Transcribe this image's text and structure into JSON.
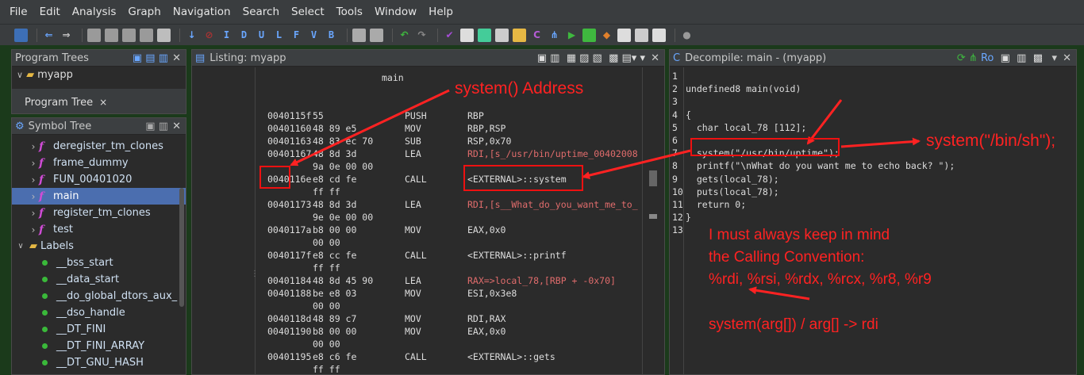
{
  "menu": [
    "File",
    "Edit",
    "Analysis",
    "Graph",
    "Navigation",
    "Search",
    "Select",
    "Tools",
    "Window",
    "Help"
  ],
  "toolbar_letters": [
    "I",
    "D",
    "U",
    "L",
    "F",
    "V",
    "B"
  ],
  "program_trees": {
    "title": "Program Trees",
    "root": "myapp",
    "tab": "Program Tree",
    "tab_close": "×"
  },
  "symbol_tree": {
    "title": "Symbol Tree",
    "functions": [
      "deregister_tm_clones",
      "frame_dummy",
      "FUN_00401020",
      "main",
      "register_tm_clones",
      "test"
    ],
    "selected": "main",
    "labels_folder": "Labels",
    "labels": [
      "__bss_start",
      "__data_start",
      "__do_global_dtors_aux_",
      "__dso_handle",
      "__DT_FINI",
      "__DT_FINI_ARRAY",
      "__DT_GNU_HASH"
    ]
  },
  "listing": {
    "title": "Listing:  myapp",
    "function_label": "main",
    "rows": [
      {
        "addr": "0040115f",
        "bytes": "55",
        "mn": "PUSH",
        "op": "RBP"
      },
      {
        "addr": "00401160",
        "bytes": "48 89 e5",
        "mn": "MOV",
        "op": "RBP,RSP"
      },
      {
        "addr": "00401163",
        "bytes": "48 83 ec 70",
        "mn": "SUB",
        "op": "RSP,0x70"
      },
      {
        "addr": "00401167",
        "bytes": "48 8d 3d",
        "mn": "LEA",
        "op": "RDI,[s_/usr/bin/uptime_00402008"
      },
      {
        "addr": "",
        "bytes": "9a 0e 00 00",
        "mn": "",
        "op": ""
      },
      {
        "addr": "0040116e",
        "bytes": "e8 cd fe",
        "mn": "CALL",
        "op": "<EXTERNAL>::system"
      },
      {
        "addr": "",
        "bytes": "ff ff",
        "mn": "",
        "op": ""
      },
      {
        "addr": "00401173",
        "bytes": "48 8d 3d",
        "mn": "LEA",
        "op": "RDI,[s__What_do_you_want_me_to_"
      },
      {
        "addr": "",
        "bytes": "9e 0e 00 00",
        "mn": "",
        "op": ""
      },
      {
        "addr": "0040117a",
        "bytes": "b8 00 00",
        "mn": "MOV",
        "op": "EAX,0x0"
      },
      {
        "addr": "",
        "bytes": "00 00",
        "mn": "",
        "op": ""
      },
      {
        "addr": "0040117f",
        "bytes": "e8 cc fe",
        "mn": "CALL",
        "op": "<EXTERNAL>::printf"
      },
      {
        "addr": "",
        "bytes": "ff ff",
        "mn": "",
        "op": ""
      },
      {
        "addr": "00401184",
        "bytes": "48 8d 45 90",
        "mn": "LEA",
        "op": "RAX=>local_78,[RBP + -0x70]"
      },
      {
        "addr": "00401188",
        "bytes": "be e8 03",
        "mn": "MOV",
        "op": "ESI,0x3e8"
      },
      {
        "addr": "",
        "bytes": "00 00",
        "mn": "",
        "op": ""
      },
      {
        "addr": "0040118d",
        "bytes": "48 89 c7",
        "mn": "MOV",
        "op": "RDI,RAX"
      },
      {
        "addr": "00401190",
        "bytes": "b8 00 00",
        "mn": "MOV",
        "op": "EAX,0x0"
      },
      {
        "addr": "",
        "bytes": "00 00",
        "mn": "",
        "op": ""
      },
      {
        "addr": "00401195",
        "bytes": "e8 c6 fe",
        "mn": "CALL",
        "op": "<EXTERNAL>::gets"
      },
      {
        "addr": "",
        "bytes": "ff ff",
        "mn": "",
        "op": ""
      }
    ]
  },
  "decompile": {
    "title": "Decompile: main - (myapp)",
    "lines": [
      {
        "n": "1",
        "code": ""
      },
      {
        "n": "2",
        "code": "undefined8 main(void)"
      },
      {
        "n": "3",
        "code": ""
      },
      {
        "n": "4",
        "code": "{"
      },
      {
        "n": "5",
        "code": "  char local_78 [112];"
      },
      {
        "n": "6",
        "code": ""
      },
      {
        "n": "7",
        "code": "  system(\"/usr/bin/uptime\");"
      },
      {
        "n": "8",
        "code": "  printf(\"\\nWhat do you want me to echo back? \");"
      },
      {
        "n": "9",
        "code": "  gets(local_78);"
      },
      {
        "n": "10",
        "code": "  puts(local_78);"
      },
      {
        "n": "11",
        "code": "  return 0;"
      },
      {
        "n": "12",
        "code": "}"
      },
      {
        "n": "13",
        "code": ""
      }
    ]
  },
  "annotations": {
    "system_address": "system() Address",
    "system_binsh": "system(\"/bin/sh\");",
    "calling_conv_1": "I must always keep in mind",
    "calling_conv_2": "the Calling Convention:",
    "calling_conv_3": "%rdi, %rsi, %rdx, %rcx, %r8, %r9",
    "arg_note": "system(arg[]) / arg[] -> rdi"
  },
  "colors": {
    "annotation": "#ff2222",
    "selection": "#4b6eaf",
    "function_icon": "#d04cd6"
  }
}
